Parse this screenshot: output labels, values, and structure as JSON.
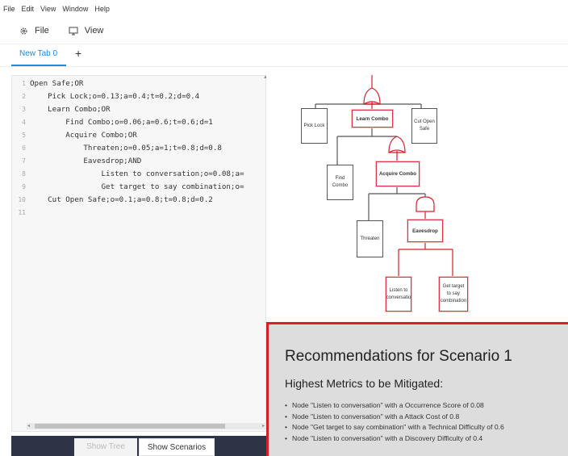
{
  "menu": [
    "File",
    "Edit",
    "View",
    "Window",
    "Help"
  ],
  "toolbar": {
    "file_label": "File",
    "view_label": "View"
  },
  "tabs": {
    "active_label": "New Tab 0",
    "add_label": "+"
  },
  "editor": {
    "lines": [
      {
        "num": "1",
        "text": "Open Safe;OR"
      },
      {
        "num": "2",
        "text": "    Pick Lock;o=0.13;a=0.4;t=0.2;d=0.4"
      },
      {
        "num": "3",
        "text": "    Learn Combo;OR"
      },
      {
        "num": "4",
        "text": "        Find Combo;o=0.06;a=0.6;t=0.6;d=1"
      },
      {
        "num": "5",
        "text": "        Acquire Combo;OR"
      },
      {
        "num": "6",
        "text": "            Threaten;o=0.05;a=1;t=0.8;d=0.8"
      },
      {
        "num": "7",
        "text": "            Eavesdrop;AND"
      },
      {
        "num": "8",
        "text": "                Listen to conversation;o=0.08;a="
      },
      {
        "num": "9",
        "text": "                Get target to say combination;o="
      },
      {
        "num": "10",
        "text": "    Cut Open Safe;o=0.1;a=0.8;t=0.8;d=0.2"
      },
      {
        "num": "11",
        "text": ""
      }
    ]
  },
  "bottom": {
    "show_tree": "Show Tree",
    "show_scenarios": "Show Scenarios"
  },
  "tree": {
    "nodes": {
      "pick_lock": "Pick Lock",
      "learn_combo": "Learn Combo",
      "cut_open_safe_1": "Cut Open",
      "cut_open_safe_2": "Safe",
      "find_combo_1": "Find",
      "find_combo_2": "Combo",
      "acquire_combo": "Acquire Combo",
      "threaten": "Threaten",
      "eavesdrop": "Eavesdrop",
      "listen_1": "Listen to",
      "listen_2": "conversatio",
      "get_target_1": "Get target",
      "get_target_2": "to say",
      "get_target_3": "combination"
    },
    "colors": {
      "highlight": "#d81f26",
      "normal": "#555555"
    }
  },
  "recommendations": {
    "title": "Recommendations for Scenario 1",
    "subtitle": "Highest Metrics to be Mitigated:",
    "items": [
      "Node \"Listen to conversation\" with a Occurrence Score of 0.08",
      "Node \"Listen to conversation\" with a Attack Cost of 0.8",
      "Node \"Get target to say combination\" with a Technical Difficulty of 0.6",
      "Node \"Listen to conversation\" with a Discovery Difficulty of 0.4"
    ]
  },
  "accent": "#1b8ae6"
}
